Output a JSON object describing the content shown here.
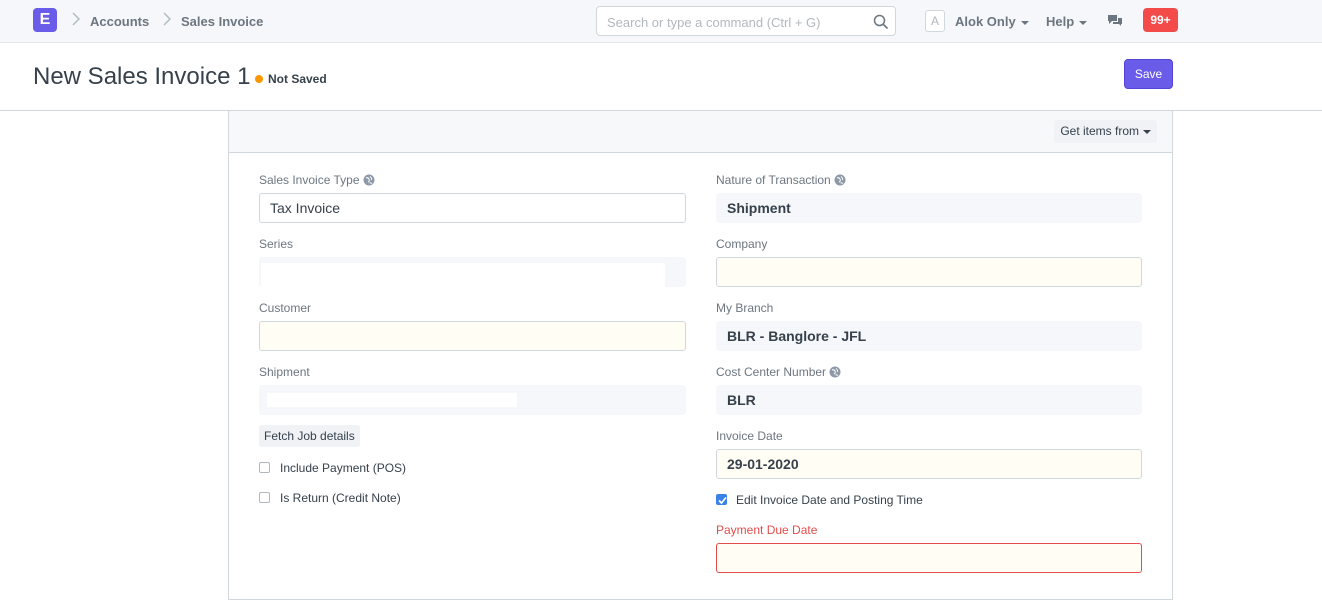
{
  "navbar": {
    "logo_letter": "E",
    "breadcrumbs": [
      "Accounts",
      "Sales Invoice"
    ],
    "search_placeholder": "Search or type a command (Ctrl + G)",
    "avatar_letter": "A",
    "user_menu": "Alok Only",
    "help_menu": "Help",
    "notification_count": "99+"
  },
  "page": {
    "title": "New Sales Invoice 1",
    "status": "Not Saved",
    "save_label": "Save"
  },
  "toolbar": {
    "get_items_label": "Get items from"
  },
  "left_fields": {
    "sales_invoice_type": {
      "label": "Sales Invoice Type",
      "value": "Tax Invoice"
    },
    "series": {
      "label": "Series",
      "value": ""
    },
    "customer": {
      "label": "Customer",
      "value": ""
    },
    "shipment": {
      "label": "Shipment",
      "value": ""
    },
    "fetch_job_label": "Fetch Job details",
    "include_payment": {
      "label": "Include Payment (POS)",
      "checked": false
    },
    "is_return": {
      "label": "Is Return (Credit Note)",
      "checked": false
    }
  },
  "right_fields": {
    "nature_of_transaction": {
      "label": "Nature of Transaction",
      "value": "Shipment"
    },
    "company": {
      "label": "Company",
      "value": ""
    },
    "my_branch": {
      "label": "My Branch",
      "value": "BLR - Banglore - JFL"
    },
    "cost_center_number": {
      "label": "Cost Center Number",
      "value": "BLR"
    },
    "invoice_date": {
      "label": "Invoice Date",
      "value": "29-01-2020"
    },
    "edit_posting_time": {
      "label": "Edit Invoice Date and Posting Time",
      "checked": true
    },
    "payment_due_date": {
      "label": "Payment Due Date",
      "value": ""
    }
  },
  "colors": {
    "brand": "#6a5ce8",
    "notification": "#f34a4a",
    "status_dot": "#ff9800",
    "error": "#e24c4c",
    "checkbox": "#3b82e6"
  }
}
